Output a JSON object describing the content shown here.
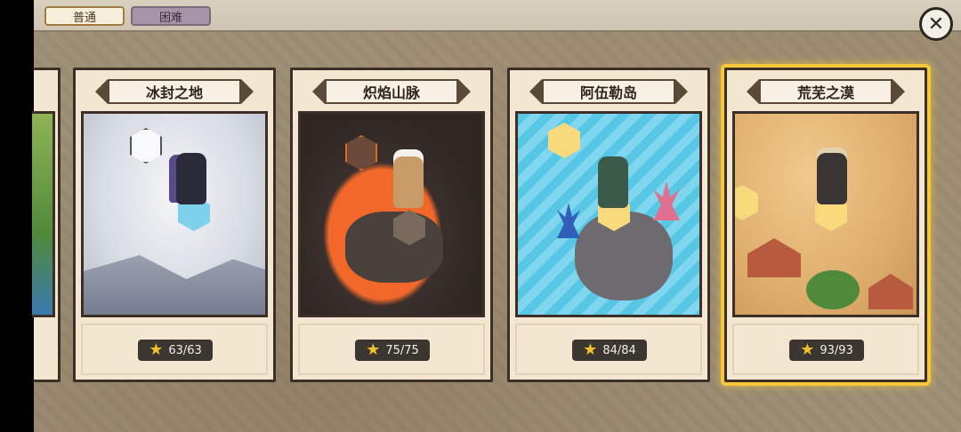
{
  "tabs": {
    "normal": "普通",
    "hard": "困难"
  },
  "close_symbol": "✕",
  "cards": [
    {
      "id": "frozen",
      "name": "冰封之地",
      "stars": "63/63"
    },
    {
      "id": "flame",
      "name": "炽焰山脉",
      "stars": "75/75"
    },
    {
      "id": "island",
      "name": "阿伍勒岛",
      "stars": "84/84"
    },
    {
      "id": "desert",
      "name": "荒芜之漠",
      "stars": "93/93"
    }
  ],
  "star_symbol": "★",
  "colors": {
    "selected_glow": "#f5c73a",
    "star": "#f4c12b",
    "hard_tab": "#a894a8"
  },
  "selected_card": "desert"
}
